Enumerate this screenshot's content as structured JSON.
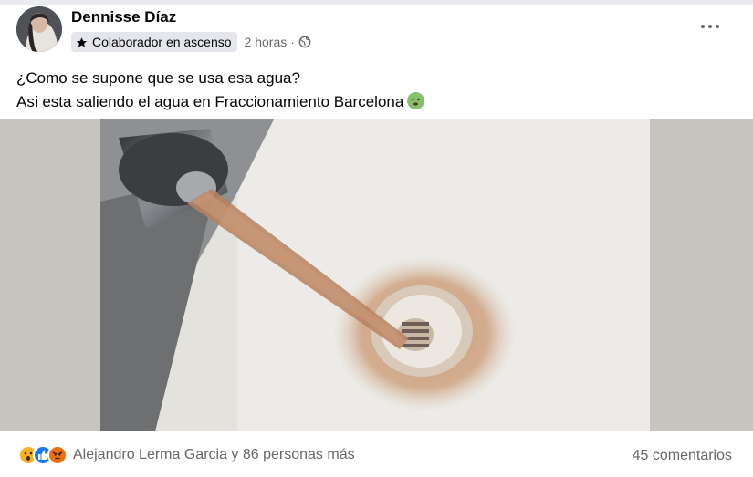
{
  "post": {
    "author": "Dennisse Díaz",
    "badge": "Colaborador en ascenso",
    "time": "2 horas",
    "separator": "·",
    "line1": "¿Como se supone que se usa esa agua?",
    "line2": "Asi esta saliendo el agua en Fraccionamiento Barcelona"
  },
  "icons": {
    "avatar": "avatar-photo",
    "badge": "star-icon",
    "privacy": "globe-icon",
    "more": "more-options-icon",
    "emoji": "nauseated-face-emoji"
  },
  "footer": {
    "reactions_text": "Alejandro Lerma Garcia y 86 personas más",
    "comments": "45 comentarios",
    "reaction_types": [
      "wow",
      "like",
      "angry"
    ]
  },
  "colors": {
    "text_secondary": "#65676b",
    "like_blue": "#1877f2",
    "wow_yellow": "#f7b125",
    "angry_orange": "#e9710f",
    "rust_water": "#b9835f"
  }
}
